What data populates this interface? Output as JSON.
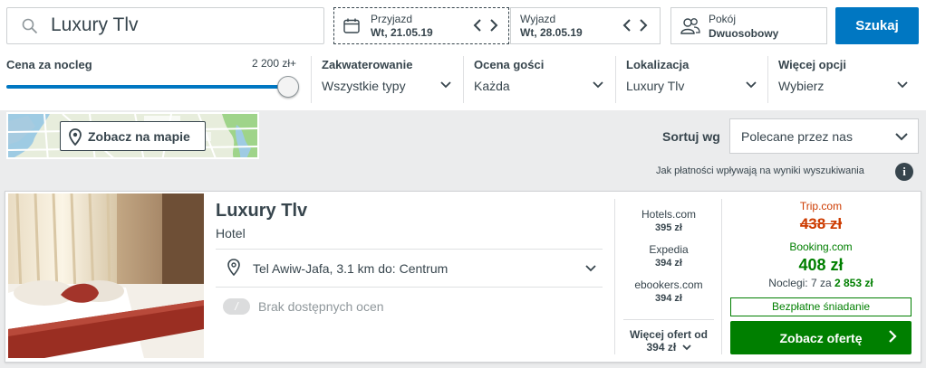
{
  "search": {
    "value": "Luxury Tlv"
  },
  "dates": {
    "checkin_label": "Przyjazd",
    "checkin_value": "Wt, 21.05.19",
    "checkout_label": "Wyjazd",
    "checkout_value": "Wt, 28.05.19"
  },
  "rooms": {
    "label": "Pokój",
    "value": "Dwuosobowy"
  },
  "search_button": "Szukaj",
  "filters": {
    "price": {
      "title": "Cena za nocleg",
      "max": "2 200 zł+",
      "level_fraction": 1.0
    },
    "accommodation": {
      "title": "Zakwaterowanie",
      "value": "Wszystkie typy"
    },
    "rating": {
      "title": "Ocena gości",
      "value": "Każda"
    },
    "location": {
      "title": "Lokalizacja",
      "value": "Luxury Tlv"
    },
    "more": {
      "title": "Więcej opcji",
      "value": "Wybierz"
    }
  },
  "map_button": "Zobacz na mapie",
  "sort": {
    "label": "Sortuj wg",
    "value": "Polecane przez nas"
  },
  "payment_info": "Jak płatności wpływają na wyniki wyszukiwania",
  "hotel": {
    "name": "Luxury Tlv",
    "type": "Hotel",
    "location": "Tel Awiw-Jafa, 3.1 km do: Centrum",
    "rating_text": "Brak dostępnych ocen",
    "deals": [
      {
        "site": "Hotels.com",
        "price": "395 zł"
      },
      {
        "site": "Expedia",
        "price": "394 zł"
      },
      {
        "site": "ebookers.com",
        "price": "394 zł"
      }
    ],
    "more_offers_label": "Więcej ofert od",
    "more_offers_price": "394 zł",
    "top_offers": {
      "crossed_site": "Trip.com",
      "crossed_price": "438 zł",
      "best_site": "Booking.com",
      "best_price": "408 zł",
      "nights_prefix": "Noclegi: 7 za",
      "nights_total": "2 853 zł",
      "breakfast": "Bezpłatne śniadanie",
      "offer_button": "Zobacz ofertę"
    }
  },
  "colors": {
    "accent": "#0077c2",
    "deal_green": "#007f00",
    "crossed_red": "#cd3b00",
    "text": "#37454d"
  }
}
